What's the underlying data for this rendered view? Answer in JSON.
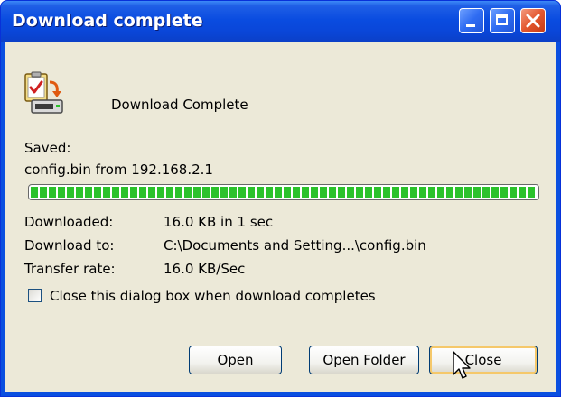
{
  "window": {
    "title": "Download complete"
  },
  "icons": {
    "main": "download-complete-icon",
    "minimize": "minimize-icon",
    "maximize": "maximize-icon",
    "close": "close-icon",
    "cursor": "mouse-pointer-icon"
  },
  "header": {
    "message": "Download Complete"
  },
  "saved": {
    "label": "Saved:",
    "file": "config.bin from 192.168.2.1"
  },
  "progress": {
    "fraction": 1.0
  },
  "details": [
    {
      "label": "Downloaded:",
      "value": "16.0 KB in 1 sec"
    },
    {
      "label": "Download to:",
      "value": "C:\\Documents and Setting...\\config.bin"
    },
    {
      "label": "Transfer rate:",
      "value": "16.0 KB/Sec"
    }
  ],
  "checkbox": {
    "label": "Close this dialog box when download completes",
    "checked": false
  },
  "buttons": {
    "open": "Open",
    "open_folder": "Open Folder",
    "close": "Close"
  },
  "colors": {
    "titlebar": "#0a4ce0",
    "dialog_background": "#ece9d8",
    "progress_fill": "#2bc22b",
    "close_button": "#e3572f",
    "default_button_highlight": "#f5c86a"
  }
}
